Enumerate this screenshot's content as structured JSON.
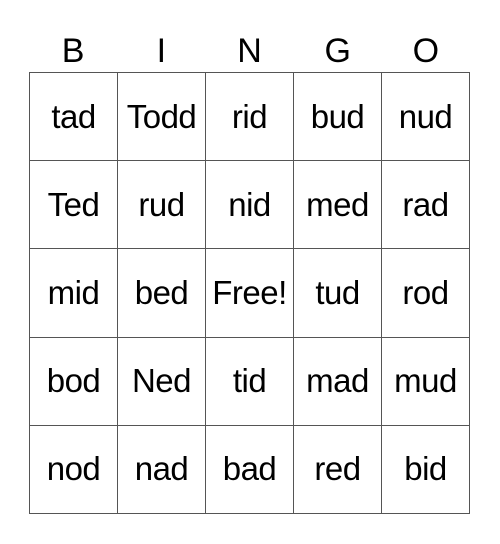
{
  "header": [
    "B",
    "I",
    "N",
    "G",
    "O"
  ],
  "rows": [
    [
      "tad",
      "Todd",
      "rid",
      "bud",
      "nud"
    ],
    [
      "Ted",
      "rud",
      "nid",
      "med",
      "rad"
    ],
    [
      "mid",
      "bed",
      "Free!",
      "tud",
      "rod"
    ],
    [
      "bod",
      "Ned",
      "tid",
      "mad",
      "mud"
    ],
    [
      "nod",
      "nad",
      "bad",
      "red",
      "bid"
    ]
  ]
}
